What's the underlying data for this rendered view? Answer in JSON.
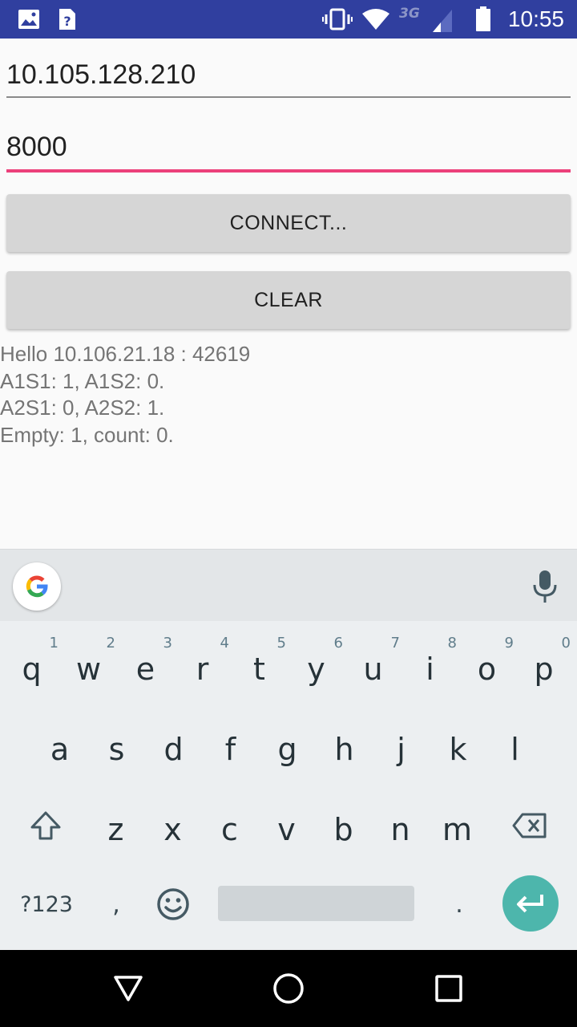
{
  "status_bar": {
    "time": "10:55",
    "network_label": "3G",
    "icons": [
      "image-notification-icon",
      "unknown-file-notification-icon",
      "vibrate-icon",
      "wifi-icon",
      "signal-icon",
      "battery-icon"
    ],
    "background_color": "#303f9f"
  },
  "form": {
    "ip_value": "10.105.128.210",
    "port_value": "8000",
    "focused_underline_color": "#ec407a"
  },
  "buttons": {
    "connect_label": "CONNECT...",
    "clear_label": "CLEAR"
  },
  "log": {
    "lines": [
      "Hello 10.106.21.18 : 42619",
      "A1S1: 1, A1S2: 0.",
      "A2S1: 0, A2S2: 1.",
      "Empty: 1, count: 0."
    ]
  },
  "keyboard": {
    "row1": [
      {
        "key": "q",
        "hint": "1"
      },
      {
        "key": "w",
        "hint": "2"
      },
      {
        "key": "e",
        "hint": "3"
      },
      {
        "key": "r",
        "hint": "4"
      },
      {
        "key": "t",
        "hint": "5"
      },
      {
        "key": "y",
        "hint": "6"
      },
      {
        "key": "u",
        "hint": "7"
      },
      {
        "key": "i",
        "hint": "8"
      },
      {
        "key": "o",
        "hint": "9"
      },
      {
        "key": "p",
        "hint": "0"
      }
    ],
    "row2": [
      "a",
      "s",
      "d",
      "f",
      "g",
      "h",
      "j",
      "k",
      "l"
    ],
    "row3": [
      "z",
      "x",
      "c",
      "v",
      "b",
      "n",
      "m"
    ],
    "symbols_label": "?123",
    "comma_label": ",",
    "period_label": ".",
    "enter_color": "#4db6ac"
  }
}
